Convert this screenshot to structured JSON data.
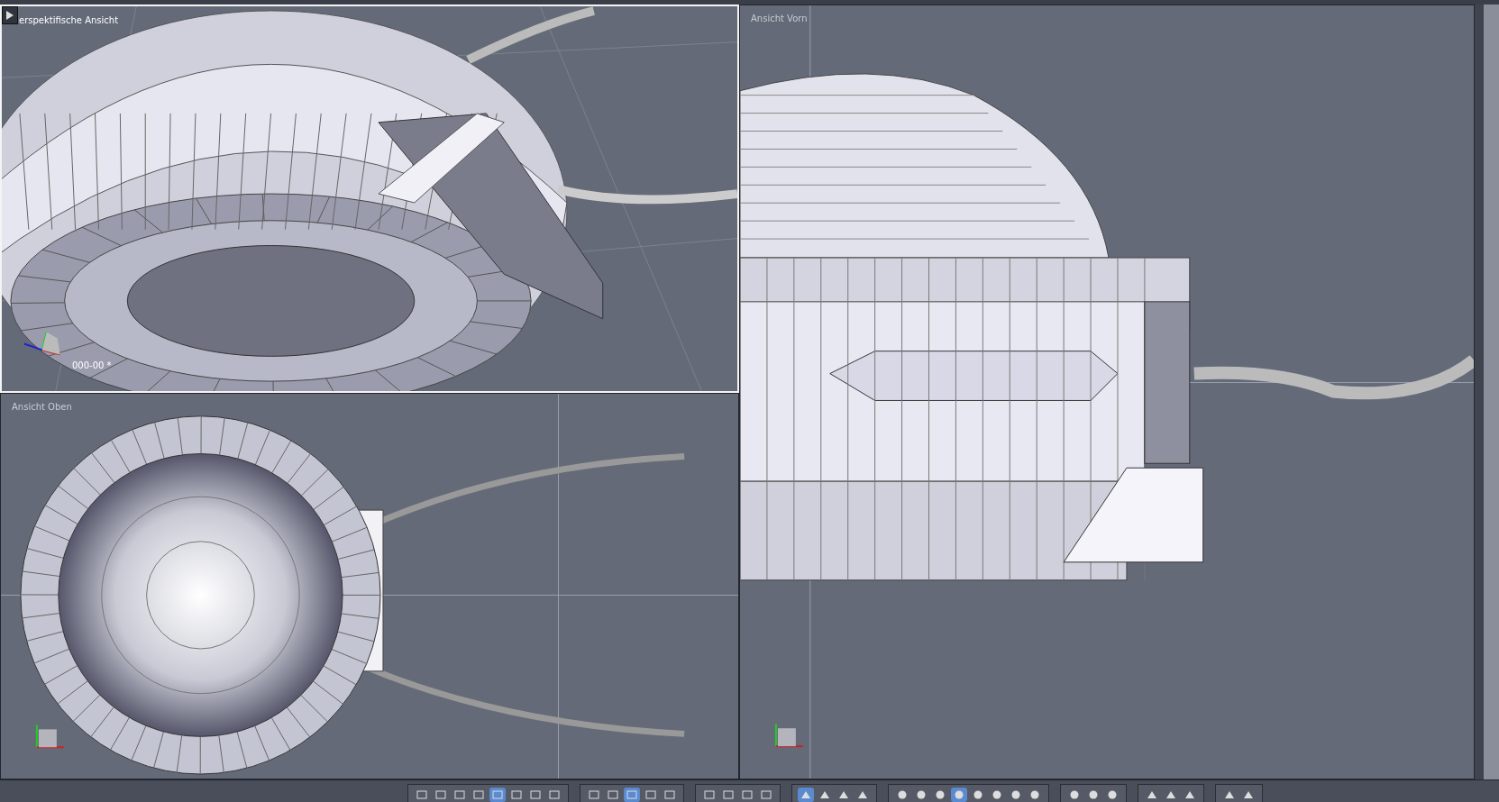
{
  "viewports": [
    {
      "kind": "perspective",
      "label": "erspektifische Ansicht",
      "active": true,
      "object_label": "000-00 *"
    },
    {
      "kind": "top",
      "label": "Ansicht Oben",
      "active": false
    },
    {
      "kind": "front",
      "label": "Ansicht Vorn",
      "active": false
    }
  ],
  "toolbar": [
    {
      "kind": "layout",
      "items": [
        {
          "selected": false
        },
        {
          "selected": false
        },
        {
          "selected": false
        },
        {
          "selected": false
        },
        {
          "selected": true
        },
        {
          "selected": false
        },
        {
          "selected": false
        },
        {
          "selected": false
        }
      ]
    },
    {
      "kind": "grid",
      "items": [
        {
          "selected": false
        },
        {
          "selected": false
        },
        {
          "selected": true
        },
        {
          "selected": false
        },
        {
          "selected": false
        }
      ]
    },
    {
      "kind": "view",
      "items": [
        {
          "selected": false
        },
        {
          "selected": false
        },
        {
          "selected": false
        },
        {
          "selected": false
        }
      ]
    },
    {
      "kind": "tool",
      "items": [
        {
          "selected": true
        },
        {
          "selected": false
        },
        {
          "selected": false
        },
        {
          "selected": false
        }
      ]
    },
    {
      "kind": "shading",
      "items": [
        {
          "selected": false
        },
        {
          "selected": false
        },
        {
          "selected": false
        },
        {
          "selected": true
        },
        {
          "selected": false
        },
        {
          "selected": false
        },
        {
          "selected": false
        },
        {
          "selected": false
        }
      ]
    },
    {
      "kind": "light",
      "items": [
        {
          "selected": false
        },
        {
          "selected": false
        },
        {
          "selected": false
        }
      ]
    },
    {
      "kind": "primitive",
      "items": [
        {
          "selected": false
        },
        {
          "selected": false
        },
        {
          "selected": false
        }
      ]
    },
    {
      "kind": "render",
      "items": [
        {
          "selected": false
        },
        {
          "selected": false
        }
      ]
    }
  ]
}
